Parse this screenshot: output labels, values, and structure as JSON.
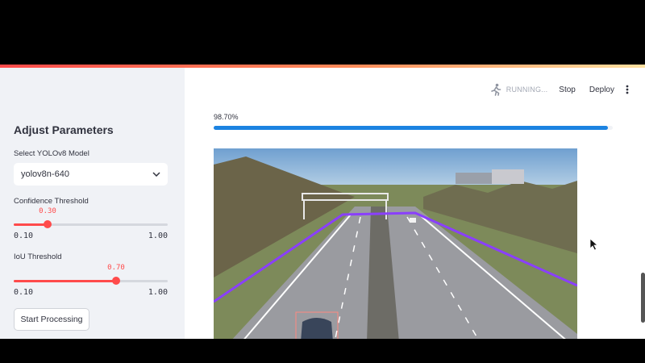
{
  "sidebar": {
    "title": "Adjust Parameters",
    "model_label": "Select YOLOv8 Model",
    "model_value": "yolov8n-640",
    "confidence": {
      "label": "Confidence Threshold",
      "value": "0.30",
      "min": "0.10",
      "max": "1.00",
      "level": 0.3
    },
    "iou": {
      "label": "IoU Threshold",
      "value": "0.70",
      "min": "0.10",
      "max": "1.00",
      "level": 0.7
    },
    "start_button": "Start Processing"
  },
  "toolbar": {
    "running_icon": "running-figure-icon",
    "status": "RUNNING...",
    "stop": "Stop",
    "deploy": "Deploy",
    "menu_icon": "more-vertical-icon"
  },
  "progress": {
    "text": "98.70%",
    "fraction": 0.987
  },
  "video": {
    "description_icon": "video-frame"
  },
  "colors": {
    "accent": "#ff4b4b",
    "progress": "#1c83e1",
    "sidebar_bg": "#f0f2f6",
    "roi_line": "#8a3ffc"
  }
}
